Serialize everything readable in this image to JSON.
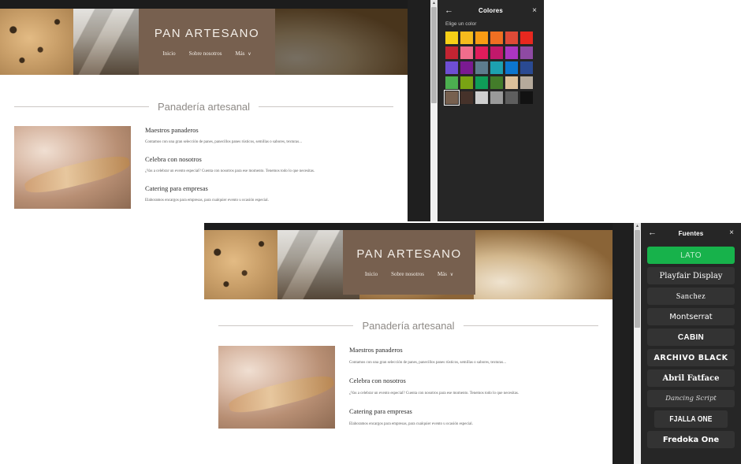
{
  "site": {
    "brand": "PAN ARTESANO",
    "nav": [
      {
        "label": "Inicio"
      },
      {
        "label": "Sobre nosotros"
      },
      {
        "label": "Más"
      }
    ],
    "nav_more_caret": "∨",
    "section_title": "Panadería artesanal",
    "items": [
      {
        "heading": "Maestros panaderos",
        "text": "Contamos con una gran selección de panes, panecillos panes rústicos, semillas o sabores, texturas..."
      },
      {
        "heading": "Celebra con nosotros",
        "text": "¿Vas a celebrar un evento especial? Cuenta con nosotros para ese momento. Tenemos todo lo que necesitas."
      },
      {
        "heading": "Catering para empresas",
        "text": "Elaboramos encargos para empresas, para cualquier evento u ocasión especial."
      }
    ],
    "header_bg": "#77604f"
  },
  "colors_panel": {
    "title": "Colores",
    "back_icon": "←",
    "close_icon": "×",
    "subtitle": "Elige un color",
    "selected_index": 24,
    "swatches": [
      "#f7cf17",
      "#f5bb1d",
      "#f89c14",
      "#ef6f22",
      "#df4a37",
      "#e8281f",
      "#c32432",
      "#f06d8c",
      "#e01c5c",
      "#c2186b",
      "#ab35c0",
      "#8e4aa3",
      "#6e4ed4",
      "#7a1a91",
      "#5d7c8d",
      "#1da1b0",
      "#0c76cf",
      "#2a4a92",
      "#4caf50",
      "#79a313",
      "#0f9d58",
      "#437c2a",
      "#dcc09a",
      "#b5aa9b",
      "#77604f",
      "#46322a",
      "#cfcfcf",
      "#9a9a9a",
      "#5e5e5e",
      "#121212"
    ]
  },
  "fonts_panel": {
    "title": "Fuentes",
    "back_icon": "←",
    "close_icon": "×",
    "active_font": "LATO",
    "fonts": [
      {
        "name": "LATO",
        "style": "f-lato",
        "active": true
      },
      {
        "name": "Playfair Display",
        "style": "f-play",
        "active": false
      },
      {
        "name": "Sanchez",
        "style": "f-sanch",
        "active": false
      },
      {
        "name": "Montserrat",
        "style": "f-monts",
        "active": false
      },
      {
        "name": "CABIN",
        "style": "f-cabin",
        "active": false
      },
      {
        "name": "ARCHIVO BLACK",
        "style": "f-arch",
        "active": false
      },
      {
        "name": "Abril Fatface",
        "style": "f-abril",
        "active": false
      },
      {
        "name": "Dancing Script",
        "style": "f-dance",
        "active": false
      },
      {
        "name": "FJALLA ONE",
        "style": "f-fjalla",
        "active": false
      },
      {
        "name": "Fredoka One",
        "style": "f-fred",
        "active": false
      }
    ]
  },
  "scroll": {
    "up_arrow": "▴"
  }
}
